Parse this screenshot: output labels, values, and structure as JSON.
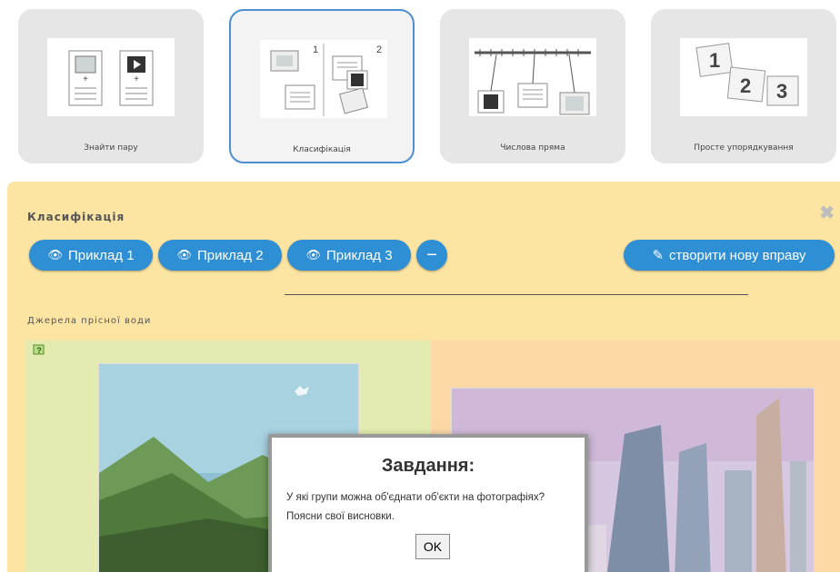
{
  "cards": [
    {
      "label": "Знайти пару"
    },
    {
      "label": "Класифікація"
    },
    {
      "label": "Числова пряма"
    },
    {
      "label": "Просте упорядкування"
    }
  ],
  "classify_thumb": {
    "n1": "1",
    "n2": "2"
  },
  "order_thumb": {
    "n1": "1",
    "n2": "2",
    "n3": "3"
  },
  "panel": {
    "title": "Класифікація",
    "examples": [
      "Приклад 1",
      "Приклад 2",
      "Приклад 3"
    ],
    "minus_label": "−",
    "create_label": "створити нову вправу",
    "subtitle": "Джерела прісної води"
  },
  "dialog": {
    "title": "Завдання:",
    "text": "У які групи можна об'єднати об'єкти на фотографіях? Поясни свої висновки.",
    "ok": "OK"
  },
  "colors": {
    "accent": "#2f8fd5",
    "panel": "#fce4a2",
    "left_zone": "#e4ebb0",
    "right_zone": "#fbd8a6"
  },
  "icons": [
    "eye-icon",
    "pencil-icon",
    "close-icon",
    "help-icon"
  ]
}
